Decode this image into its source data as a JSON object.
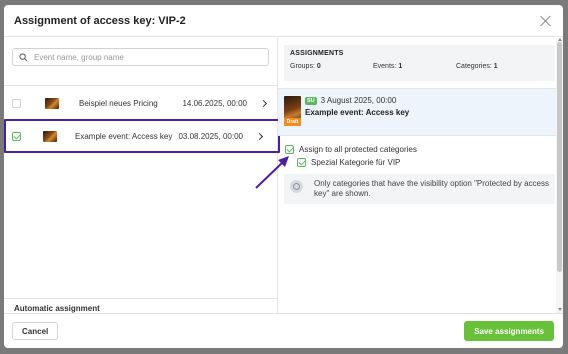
{
  "modal": {
    "title": "Assignment of access key: VIP-2"
  },
  "search": {
    "placeholder": "Event name, group name"
  },
  "events": [
    {
      "name": "Beispiel neues Pricing",
      "date": "14.06.2025, 00:00",
      "checked": false
    },
    {
      "name": "Example event: Access key",
      "date": "03.08.2025, 00:00",
      "checked": true
    }
  ],
  "assignments": {
    "title": "ASSIGNMENTS",
    "groups_label": "Groups:",
    "groups_count": "0",
    "events_label": "Events:",
    "events_count": "1",
    "categories_label": "Categories:",
    "categories_count": "1"
  },
  "detail": {
    "badge": "SU",
    "date": "3 August 2025, 00:00",
    "name": "Example event: Access key",
    "status": "Draft"
  },
  "categories": {
    "all_label": "Assign to all protected categories",
    "item_label": "Spezial Kategorie für VIP"
  },
  "info": {
    "text": "Only categories that have the visibility option \"Protected by access key\" are shown."
  },
  "automatic": {
    "label": "Automatic assignment"
  },
  "footer": {
    "cancel_label": "Cancel",
    "save_label": "Save assignments"
  },
  "colors": {
    "accent_green": "#67c23a",
    "highlight_border": "#4a1fa8",
    "draft_orange": "#f28c1b"
  }
}
